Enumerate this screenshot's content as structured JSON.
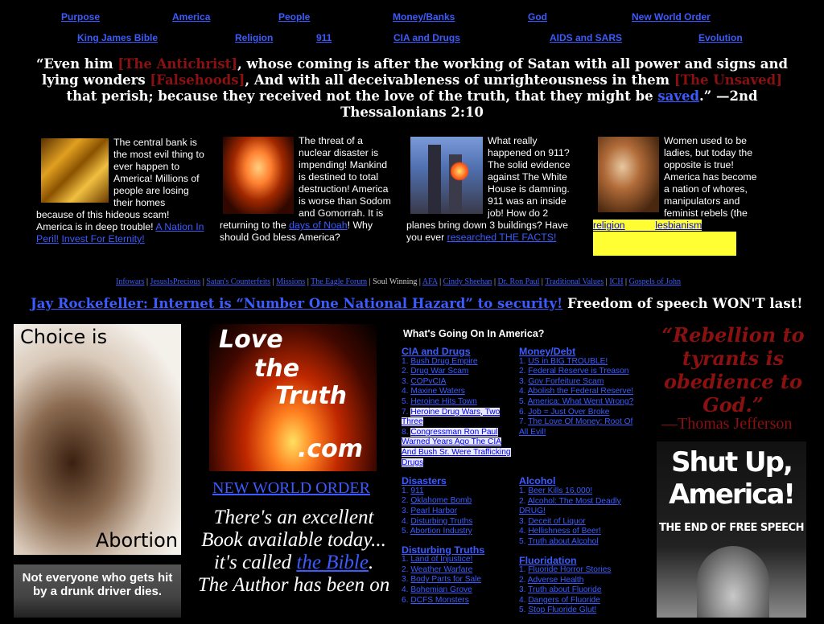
{
  "nav": {
    "row1": [
      "Purpose",
      "America",
      "People",
      "Money/Banks",
      "God",
      "New World Order"
    ],
    "row2": [
      "King James Bible",
      "Religion",
      "911",
      "CIA and Drugs",
      "AIDS and SARS",
      "Evolution"
    ]
  },
  "quote": {
    "p1": "“Even him ",
    "r1": "[The Antichrist]",
    "p2": ", whose coming is after the working of Satan with all power and signs and lying wonders ",
    "r2": "[Falsehoods]",
    "p3": ", And with all deceivableness of unrighteousness in them ",
    "r3": "[The Unsaved]",
    "p4": " that perish; because they received not the love of the truth, that they might be ",
    "link": "saved",
    "p5": ".” —2nd Thessalonians 2:10"
  },
  "blurbs": {
    "bank": {
      "text": "The central bank is the most evil thing to ever happen to America! Millions of people are losing their homes because of this hideous scam! America is in deep trouble! ",
      "link1": "A Nation In Peril!",
      "link2": "Invest For Eternity!"
    },
    "nuke": {
      "text": "The threat of a nuclear disaster is impending! Mankind is destined to total destruction! America is worse than Sodom and Gomorrah. It is returning to the ",
      "link": "days of Noah",
      "text2": "! Why should God bless America?"
    },
    "wtc": {
      "text": "What really happened on 911? The solid evidence against The White House is damning. 911 was an inside job! How do 2 planes bring down 3 buildings? Have you ever ",
      "link": "researched THE FACTS!"
    },
    "women": {
      "text": "Women used to be ladies, but today the opposite is true! America has become a nation of whores, manipulators and feminist rebels (the ",
      "link1": "religion",
      "link2": "lesbianism"
    }
  },
  "links2": [
    "Infowars",
    "JesusIsPrecious",
    "Satan's Counterfeits",
    "Missions",
    "The Eagle Forum",
    "Soul Winning",
    "AFA",
    "Cindy Sheehan",
    "Dr. Ron Paul",
    "Traditional Values",
    "ICH",
    "Gospels of John"
  ],
  "links2_plain": "Soul Winning",
  "headline": {
    "link": "Jay Rockefeller: Internet is “Number One National Hazard” to security!",
    "text": "Freedom of speech WON'T last!"
  },
  "choice": {
    "top": "Choice is",
    "bottom": "Abortion"
  },
  "drunk": {
    "text": "Not everyone who gets hit by a drunk driver dies."
  },
  "love": {
    "l1": "Love",
    "l2": "the",
    "l3": "Truth",
    "l4": ".com"
  },
  "nwo": "NEW WORLD ORDER",
  "book": {
    "t1": "There's an excellent Book available today... it's called ",
    "link": "the Bible",
    "t2": ". The Author has been on"
  },
  "whats": "What's Going On In America?",
  "lists": {
    "cia": {
      "title": "CIA and Drugs",
      "items": [
        "Bush Drug Empire",
        "Drug War Scam",
        "COPvCIA",
        "Maxine Waters",
        "Heroine Hits Town",
        "Heroine Drug Wars, Two Three",
        "Congressman Ron Paul Warned Years Ago The CIA And Bush Sr. Were Trafficking Drugs"
      ]
    },
    "money": {
      "title": "Money/Debt",
      "items": [
        "US in BIG TROUBLE!",
        "Federal Reserve is Treason",
        "Gov Forfeiture Scam",
        "Abolish the Federal Reserve!",
        "America: What Went Wrong?",
        "Job = Just Over Broke",
        "The Love Of Money: Root Of All Evil!"
      ]
    },
    "disasters": {
      "title": "Disasters",
      "items": [
        "911",
        "Oklahome Bomb",
        "Pearl Harbor",
        "Disturbing Truths",
        "Abortion Industry"
      ]
    },
    "alcohol": {
      "title": "Alcohol",
      "items": [
        "Beer Kills 16,000!",
        "Alcohol: The Most Deadly DRUG!",
        "Deceit of Liquor",
        "Hellishness of Beer!",
        "Truth about Alcohol"
      ]
    },
    "truths": {
      "title": "Disturbing Truths",
      "items": [
        "Land of Injustice!",
        "Weather Warfare",
        "Body Parts for Sale",
        "Bohemian Grove",
        "DCFS Monsters"
      ]
    },
    "fluor": {
      "title": "Fluoridation",
      "items": [
        "Fluoride Horror Stories",
        "Adverse Health",
        "Truth about Fluoride",
        "Dangers of Fluoride",
        "Stop Fluoride Glut!"
      ]
    }
  },
  "rebel": {
    "quote": "“Rebellion to tyrants is obedience to God.”",
    "by": "—Thomas Jefferson"
  },
  "shutup": {
    "l1": "Shut Up,",
    "l2": "America!",
    "l3": "THE END OF FREE SPEECH"
  }
}
